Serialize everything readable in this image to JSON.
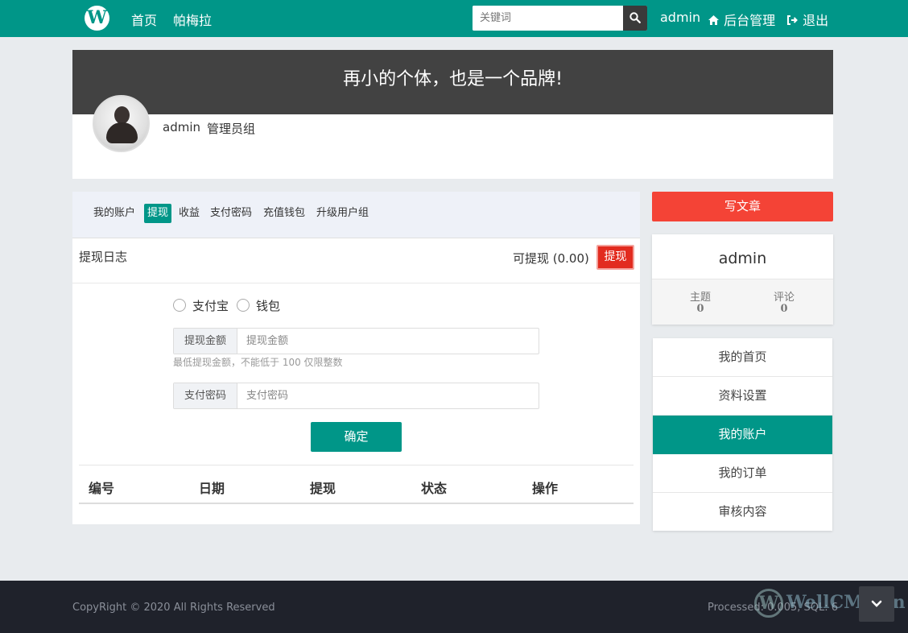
{
  "nav": {
    "logo_letter": "W",
    "links": [
      "首页",
      "帕梅拉"
    ],
    "search_placeholder": "关键词",
    "user": "admin",
    "admin_label": "后台管理",
    "logout_label": "退出"
  },
  "hero": {
    "slogan": "再小的个体，也是一个品牌!",
    "username": "admin",
    "group": "管理员组"
  },
  "tabs": [
    "我的账户",
    "提现",
    "收益",
    "支付密码",
    "充值钱包",
    "升级用户组"
  ],
  "active_tab": "提现",
  "withdraw": {
    "log_title": "提现日志",
    "available_text": "可提现 (0.00)",
    "withdraw_button": "提现",
    "methods": [
      "支付宝",
      "钱包"
    ],
    "amount_label": "提现金额",
    "amount_placeholder": "提现金额",
    "hint": "最低提现金额，不能低于 100 仅限整数",
    "password_label": "支付密码",
    "password_placeholder": "支付密码",
    "confirm_button": "确定"
  },
  "table": {
    "columns": [
      "编号",
      "日期",
      "提现",
      "状态",
      "操作"
    ]
  },
  "sidebar": {
    "write_button": "写文章",
    "card": {
      "name": "admin",
      "topics_label": "主题",
      "topics_value": "0",
      "comments_label": "评论",
      "comments_value": "0"
    },
    "menu": [
      "我的首页",
      "资料设置",
      "我的账户",
      "我的订单",
      "审核内容"
    ],
    "active_menu": "我的账户"
  },
  "footer": {
    "copyright": "CopyRight © 2020 All Rights Reserved",
    "processed": "Processed: 0.005, SQL: 6",
    "watermark": "WellCMS.cn",
    "watermark_letter": "W"
  },
  "colors": {
    "primary": "#009688",
    "danger": "#f44336",
    "footer": "#1f222b"
  }
}
